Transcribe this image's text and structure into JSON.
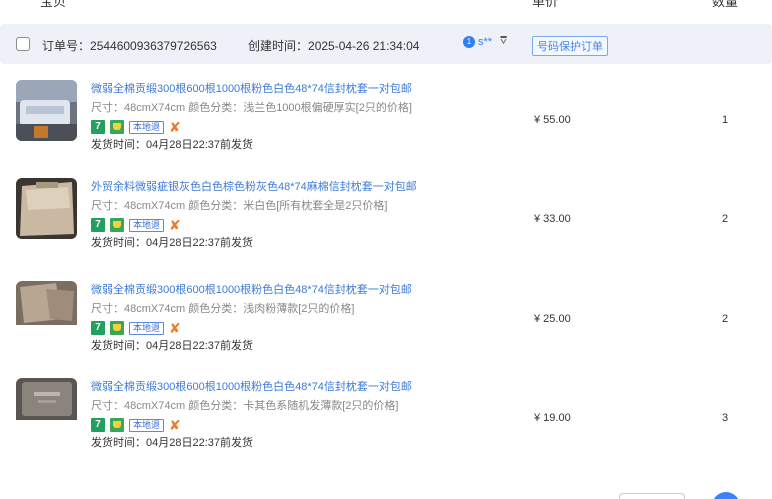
{
  "header": {
    "product_label": "宝贝",
    "price_label": "单价",
    "qty_label": "数量"
  },
  "order": {
    "order_no_label": "订单号：",
    "order_no": "2544600936379726563",
    "created_label": "创建时间：",
    "created_at": "2025-04-26 21:34:04",
    "buyer_badge": "1",
    "buyer": "s**",
    "protect_badge": "号码保护订单"
  },
  "items": [
    {
      "title": "微弱全棉贡缎300根600根1000根粉色白色48*74信封枕套一对包邮",
      "sku": "尺寸：48cmX74cm  颜色分类：浅兰色1000根偏硬厚实[2只的价格]",
      "local_tag": "本地退",
      "ship_time": "发货时间：04月28日22:37前发货",
      "price": "¥ 55.00",
      "qty": "1"
    },
    {
      "title": "外贸余料微弱疵银灰色白色棕色粉灰色48*74麻棉信封枕套一对包邮",
      "sku": "尺寸：48cmX74cm  颜色分类：米白色[所有枕套全是2只价格]",
      "local_tag": "本地退",
      "ship_time": "发货时间：04月28日22:37前发货",
      "price": "¥ 33.00",
      "qty": "2"
    },
    {
      "title": "微弱全棉贡缎300根600根1000根粉色白色48*74信封枕套一对包邮",
      "sku": "尺寸：48cmX74cm  颜色分类：浅肉粉薄款[2只的价格]",
      "local_tag": "本地退",
      "ship_time": "发货时间：04月28日22:37前发货",
      "price": "¥ 25.00",
      "qty": "2"
    },
    {
      "title": "微弱全棉贡缎300根600根1000根粉色白色48*74信封枕套一对包邮",
      "sku": "尺寸：48cmX74cm  颜色分类：卡其色系随机发薄款[2只的价格]",
      "local_tag": "本地退",
      "ship_time": "发货时间：04月28日22:37前发货",
      "price": "¥ 19.00",
      "qty": "3"
    }
  ],
  "colors": {
    "link_blue": "#3d7bd8",
    "order_bar_bg": "#eef1f8",
    "seven_day_tag": "#22a060",
    "local_tag": "#3d6fd0",
    "accent_orange": "#f07a2a"
  },
  "icons": {
    "seven_day": "7",
    "item_x": "✘",
    "filter": "⩢"
  }
}
